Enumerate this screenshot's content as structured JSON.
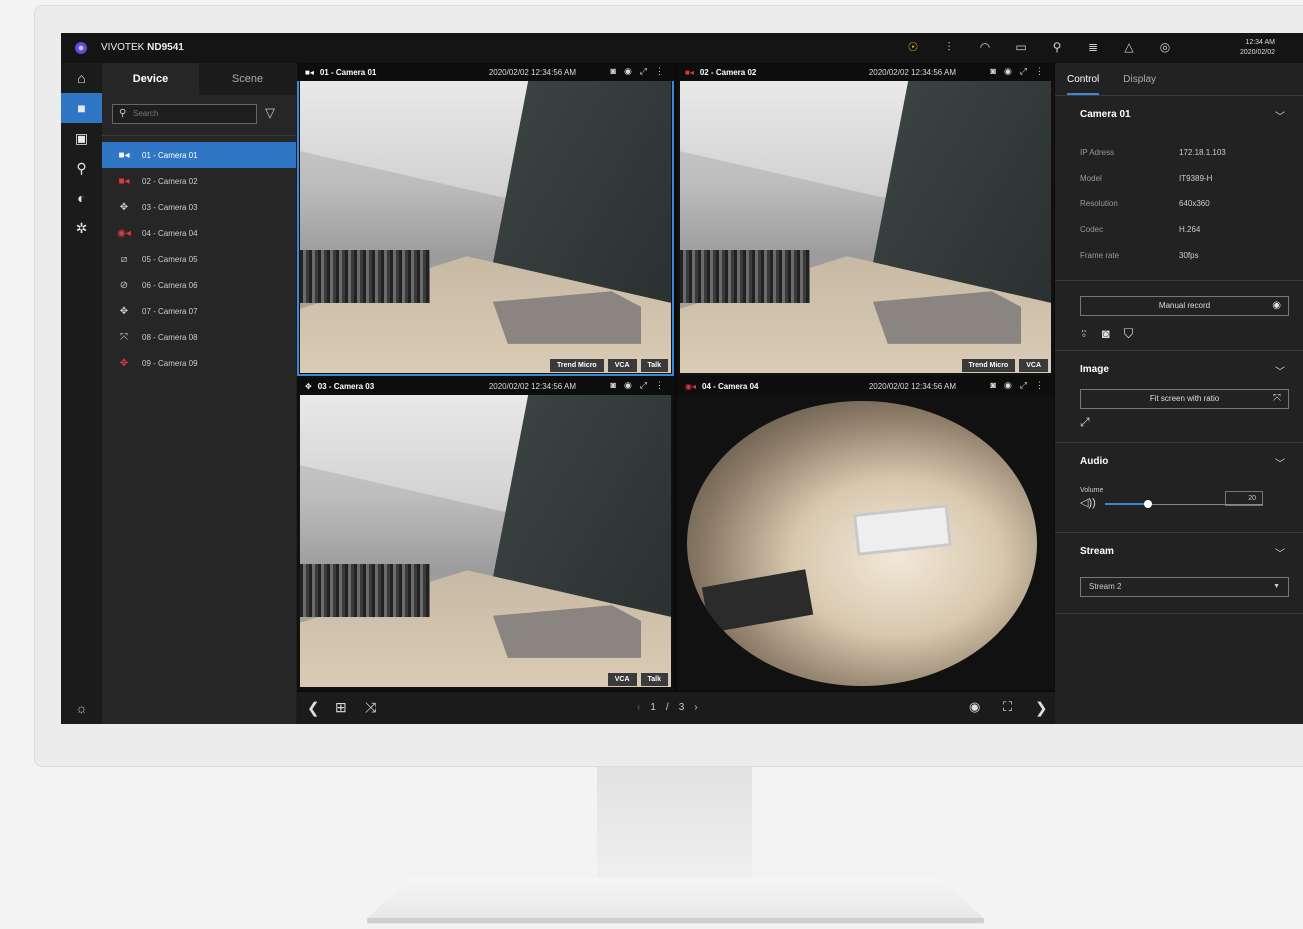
{
  "app": {
    "brand_prefix": "VIVOTEK",
    "brand_model": "ND9541",
    "clock_time": "12:34 AM",
    "clock_date": "2020/02/02"
  },
  "sysicons": [
    "alert-icon",
    "gps-signal-icon",
    "wifi-icon",
    "screen-icon",
    "usb-icon",
    "database-icon",
    "bell-icon",
    "user-icon"
  ],
  "rail": [
    "home-icon",
    "camera-icon",
    "playback-icon",
    "search-icon",
    "event-icon",
    "settings-icon"
  ],
  "device_panel": {
    "tabs": [
      "Device",
      "Scene"
    ],
    "search_placeholder": "Search",
    "cameras": [
      {
        "label": "01 - Camera 01",
        "icon": "camera-icon",
        "status": "normal"
      },
      {
        "label": "02 - Camera 02",
        "icon": "camera-recording-icon",
        "status": "recording"
      },
      {
        "label": "03 - Camera 03",
        "icon": "ptz-icon",
        "status": "normal"
      },
      {
        "label": "04 - Camera 04",
        "icon": "fisheye-recording-icon",
        "status": "recording"
      },
      {
        "label": "05 - Camera 05",
        "icon": "camera-offline-icon",
        "status": "offline"
      },
      {
        "label": "06 - Camera 06",
        "icon": "fisheye-offline-icon",
        "status": "offline"
      },
      {
        "label": "07 - Camera 07",
        "icon": "ptz-icon",
        "status": "normal"
      },
      {
        "label": "08 - Camera 08",
        "icon": "ptz-offline-icon",
        "status": "offline"
      },
      {
        "label": "09 - Camera 09",
        "icon": "ptz-recording-icon",
        "status": "recording"
      }
    ]
  },
  "tiles": [
    {
      "name": "01 - Camera 01",
      "time": "2020/02/02  12:34:56  AM",
      "badges": [
        "Trend Micro",
        "VCA",
        "Talk"
      ],
      "type": "store"
    },
    {
      "name": "02 - Camera 02",
      "time": "2020/02/02  12:34:56  AM",
      "badges": [
        "Trend Micro",
        "VCA"
      ],
      "type": "store"
    },
    {
      "name": "03 - Camera 03",
      "time": "2020/02/02  12:34:56  AM",
      "badges": [
        "VCA",
        "Talk"
      ],
      "type": "store"
    },
    {
      "name": "04 - Camera 04",
      "time": "2020/02/02  12:34:56  AM",
      "badges": [],
      "type": "fisheye"
    }
  ],
  "footer": {
    "page_current": "1",
    "page_sep": "/",
    "page_total": "3"
  },
  "right_panel": {
    "tabs": [
      "Control",
      "Display"
    ],
    "camera_section": {
      "title": "Camera 01",
      "rows": [
        {
          "k": "IP Adress",
          "v": "172.18.1.103"
        },
        {
          "k": "Model",
          "v": "IT9389-H"
        },
        {
          "k": "Resolution",
          "v": "640x360"
        },
        {
          "k": "Codec",
          "v": "H.264"
        },
        {
          "k": "Frame rate",
          "v": "30fps"
        }
      ]
    },
    "manual_record": "Manual record",
    "image": {
      "title": "Image",
      "fit": "Fit screen with ratio"
    },
    "audio": {
      "title": "Audio",
      "volume_label": "Volume",
      "volume": "20",
      "volume_level": 0.27
    },
    "stream": {
      "title": "Stream",
      "selected": "Stream 2"
    }
  },
  "colors": {
    "accent": "#2f77c4",
    "alert": "#f0b400",
    "recording": "#e23a3a"
  }
}
